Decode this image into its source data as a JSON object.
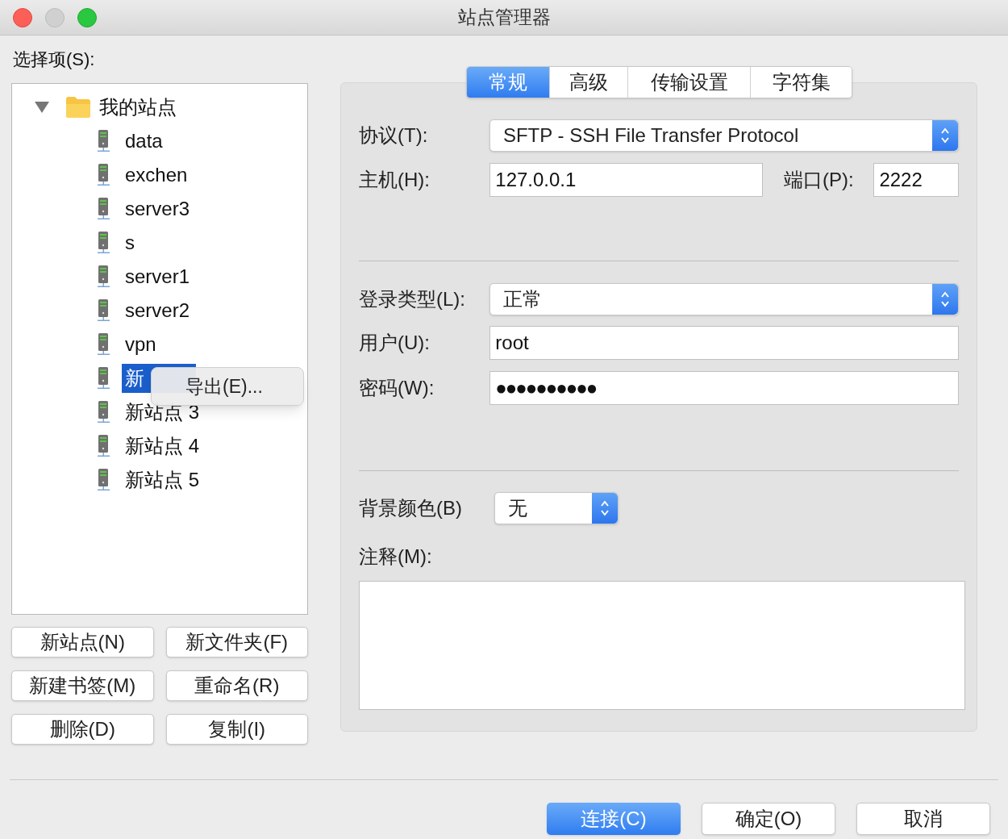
{
  "window": {
    "title": "站点管理器"
  },
  "tree": {
    "label": "选择项(S):",
    "root": {
      "label": "我的站点",
      "expanded": true,
      "children": [
        {
          "label": "data",
          "selected": false
        },
        {
          "label": "exchen",
          "selected": false
        },
        {
          "label": "server3",
          "selected": false
        },
        {
          "label": "s",
          "selected": false
        },
        {
          "label": "server1",
          "selected": false
        },
        {
          "label": "server2",
          "selected": false
        },
        {
          "label": "vpn",
          "selected": false
        },
        {
          "label": "新",
          "selected": true
        },
        {
          "label": "新站点 3",
          "selected": false
        },
        {
          "label": "新站点 4",
          "selected": false
        },
        {
          "label": "新站点 5",
          "selected": false
        }
      ]
    }
  },
  "context_menu": {
    "items": [
      "导出(E)..."
    ]
  },
  "site_buttons": [
    "新站点(N)",
    "新文件夹(F)",
    "新建书签(M)",
    "重命名(R)",
    "删除(D)",
    "复制(I)"
  ],
  "tabs": [
    {
      "label": "常规",
      "selected": true
    },
    {
      "label": "高级",
      "selected": false
    },
    {
      "label": "传输设置",
      "selected": false
    },
    {
      "label": "字符集",
      "selected": false
    }
  ],
  "general": {
    "protocol": {
      "label": "协议(T):",
      "value": "SFTP - SSH File Transfer Protocol"
    },
    "host": {
      "label": "主机(H):",
      "value": "127.0.0.1"
    },
    "port": {
      "label": "端口(P):",
      "value": "2222"
    },
    "logon_type": {
      "label": "登录类型(L):",
      "value": "正常"
    },
    "user": {
      "label": "用户(U):",
      "value": "root"
    },
    "password": {
      "label": "密码(W):",
      "value": "●●●●●●●●●●"
    },
    "background_color": {
      "label": "背景颜色(B)",
      "value": "无"
    },
    "comment": {
      "label": "注释(M):"
    }
  },
  "bottom_buttons": [
    {
      "label": "连接(C)",
      "default": true
    },
    {
      "label": "确定(O)",
      "default": false
    },
    {
      "label": "取消",
      "default": false
    }
  ]
}
